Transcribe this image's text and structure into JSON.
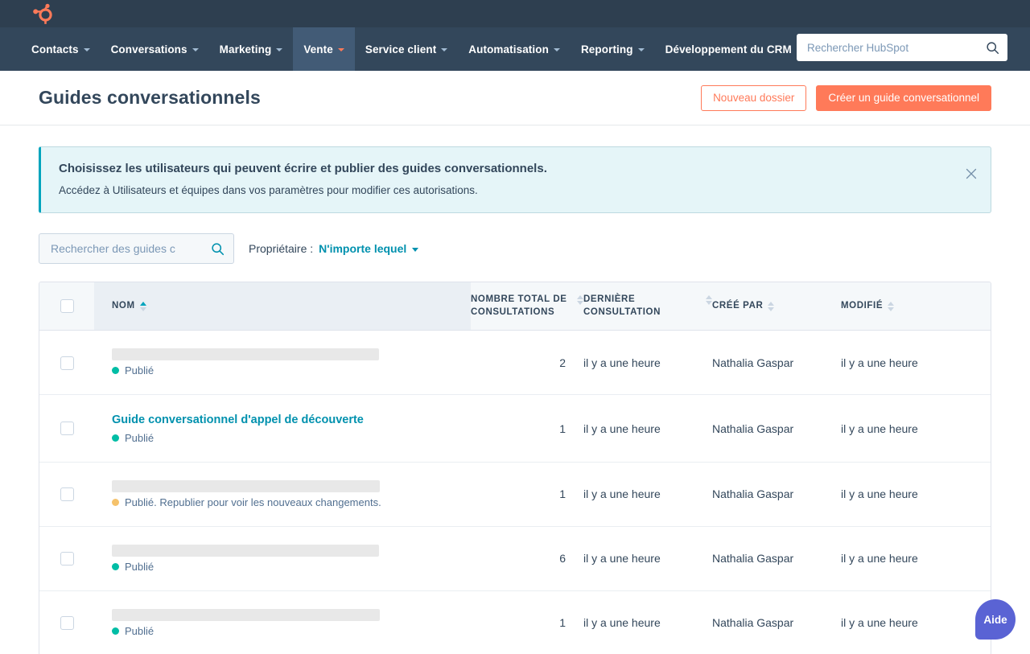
{
  "nav": {
    "logo_icon": "hubspot-sprocket-logo",
    "items": [
      {
        "label": "Contacts",
        "has_caret": true,
        "active": false
      },
      {
        "label": "Conversations",
        "has_caret": true,
        "active": false
      },
      {
        "label": "Marketing",
        "has_caret": true,
        "active": false
      },
      {
        "label": "Vente",
        "has_caret": true,
        "active": true
      },
      {
        "label": "Service client",
        "has_caret": true,
        "active": false
      },
      {
        "label": "Automatisation",
        "has_caret": true,
        "active": false
      },
      {
        "label": "Reporting",
        "has_caret": true,
        "active": false
      },
      {
        "label": "Développement du CRM",
        "has_caret": false,
        "active": false
      }
    ],
    "search": {
      "value": "",
      "placeholder": "Rechercher HubSpot",
      "icon": "search-icon"
    }
  },
  "header": {
    "title": "Guides conversationnels",
    "secondary_button": "Nouveau dossier",
    "primary_button": "Créer un guide conversationnel"
  },
  "banner": {
    "title": "Choisissez les utilisateurs qui peuvent écrire et publier des guides conversationnels.",
    "subtitle": "Accédez à Utilisateurs et équipes dans vos paramètres pour modifier ces autorisations.",
    "close_icon": "close-icon"
  },
  "filters": {
    "search": {
      "value": "",
      "placeholder": "Rechercher des guides c",
      "icon": "search-icon"
    },
    "owner_label": "Propriétaire :",
    "owner_value": "N'importe lequel"
  },
  "table": {
    "columns": [
      {
        "key": "name",
        "label": "NOM",
        "sort": "asc"
      },
      {
        "key": "views",
        "label": "NOMBRE TOTAL DE CONSULTATIONS",
        "sort": "none"
      },
      {
        "key": "last",
        "label": "DERNIÈRE CONSULTATION",
        "sort": "none"
      },
      {
        "key": "by",
        "label": "CRÉÉ PAR",
        "sort": "none"
      },
      {
        "key": "mod",
        "label": "MODIFIÉ",
        "sort": "none"
      }
    ],
    "rows": [
      {
        "name": "",
        "redacted": true,
        "redacted_width": 332,
        "status": "Publié",
        "status_color": "#00bda5",
        "views": "2",
        "last": "il y a une heure",
        "by": "Nathalia Gaspar",
        "mod": "il y a une heure"
      },
      {
        "name": "Guide conversationnel d'appel de découverte",
        "redacted": false,
        "redacted_width": 0,
        "status": "Publié",
        "status_color": "#00bda5",
        "views": "1",
        "last": "il y a une heure",
        "by": "Nathalia Gaspar",
        "mod": "il y a une heure"
      },
      {
        "name": "",
        "redacted": true,
        "redacted_width": 333,
        "status": "Publié. Republier pour voir les nouveaux changements.",
        "status_color": "#f5c26b",
        "views": "1",
        "last": "il y a une heure",
        "by": "Nathalia Gaspar",
        "mod": "il y a une heure"
      },
      {
        "name": "",
        "redacted": true,
        "redacted_width": 332,
        "status": "Publié",
        "status_color": "#00bda5",
        "views": "6",
        "last": "il y a une heure",
        "by": "Nathalia Gaspar",
        "mod": "il y a une heure"
      },
      {
        "name": "",
        "redacted": true,
        "redacted_width": 333,
        "status": "Publié",
        "status_color": "#00bda5",
        "views": "1",
        "last": "il y a une heure",
        "by": "Nathalia Gaspar",
        "mod": "il y a une heure"
      }
    ]
  },
  "help": {
    "label": "Aide"
  },
  "colors": {
    "nav_bg": "#2e3f50",
    "nav_row_bg": "#33475b",
    "accent_orange": "#ff7a59",
    "link_teal": "#0091ae",
    "status_green": "#00bda5",
    "status_amber": "#f5c26b",
    "banner_bg": "#e5f5f8",
    "banner_border": "#00a4bd",
    "help_purple": "#5a63d4"
  }
}
